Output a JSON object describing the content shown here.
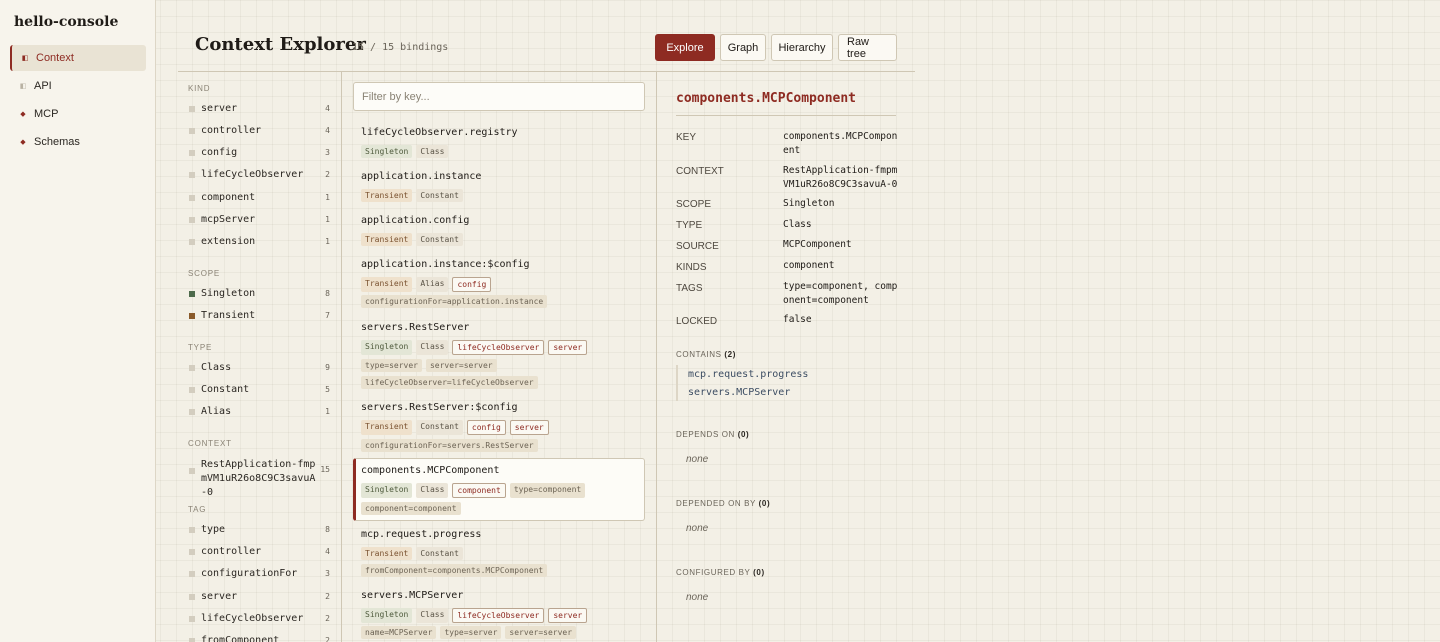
{
  "app": {
    "brand": "hello-console"
  },
  "nav": [
    {
      "label": "Context",
      "icon": "context-icon"
    },
    {
      "label": "API",
      "icon": "api-icon"
    },
    {
      "label": "MCP",
      "icon": "mcp-icon"
    },
    {
      "label": "Schemas",
      "icon": "schemas-icon"
    }
  ],
  "header": {
    "title": "Context Explorer",
    "count": "15 / 15 bindings",
    "views": [
      "Explore",
      "Graph",
      "Hierarchy",
      "Raw tree"
    ],
    "active_view": "Explore"
  },
  "facets": {
    "kind": {
      "heading": "KIND",
      "items": [
        {
          "label": "server",
          "count": "4"
        },
        {
          "label": "controller",
          "count": "4"
        },
        {
          "label": "config",
          "count": "3"
        },
        {
          "label": "lifeCycleObserver",
          "count": "2"
        },
        {
          "label": "component",
          "count": "1"
        },
        {
          "label": "mcpServer",
          "count": "1"
        },
        {
          "label": "extension",
          "count": "1"
        }
      ]
    },
    "scope": {
      "heading": "SCOPE",
      "items": [
        {
          "label": "Singleton",
          "count": "8"
        },
        {
          "label": "Transient",
          "count": "7"
        }
      ]
    },
    "type": {
      "heading": "TYPE",
      "items": [
        {
          "label": "Class",
          "count": "9"
        },
        {
          "label": "Constant",
          "count": "5"
        },
        {
          "label": "Alias",
          "count": "1"
        }
      ]
    },
    "context": {
      "heading": "CONTEXT",
      "items": [
        {
          "label": "RestApplication-fmpmVM1uR26o8C9C3savuA-0",
          "count": "15"
        }
      ]
    },
    "tag": {
      "heading": "TAG",
      "items": [
        {
          "label": "type",
          "count": "8"
        },
        {
          "label": "controller",
          "count": "4"
        },
        {
          "label": "configurationFor",
          "count": "3"
        },
        {
          "label": "server",
          "count": "2"
        },
        {
          "label": "lifeCycleObserver",
          "count": "2"
        },
        {
          "label": "fromComponent",
          "count": "2"
        }
      ]
    }
  },
  "filter": {
    "placeholder": "Filter by key...",
    "value": ""
  },
  "bindings": [
    {
      "key": "lifeCycleObserver.registry",
      "rows": [
        [
          "Singleton",
          "Class"
        ]
      ]
    },
    {
      "key": "application.instance",
      "rows": [
        [
          "Transient",
          "Constant"
        ]
      ]
    },
    {
      "key": "application.config",
      "rows": [
        [
          "Transient",
          "Constant"
        ]
      ]
    },
    {
      "key": "application.instance:$config",
      "rows": [
        [
          "Transient",
          "Alias",
          "config"
        ],
        [
          "configurationFor=application.instance"
        ]
      ]
    },
    {
      "key": "servers.RestServer",
      "rows": [
        [
          "Singleton",
          "Class",
          "lifeCycleObserver",
          "server"
        ],
        [
          "type=server",
          "server=server"
        ],
        [
          "lifeCycleObserver=lifeCycleObserver"
        ]
      ]
    },
    {
      "key": "servers.RestServer:$config",
      "rows": [
        [
          "Transient",
          "Constant",
          "config",
          "server"
        ],
        [
          "configurationFor=servers.RestServer"
        ]
      ]
    },
    {
      "key": "components.MCPComponent",
      "rows": [
        [
          "Singleton",
          "Class",
          "component",
          "type=component"
        ],
        [
          "component=component"
        ]
      ]
    },
    {
      "key": "mcp.request.progress",
      "rows": [
        [
          "Transient",
          "Constant"
        ],
        [
          "fromComponent=components.MCPComponent"
        ]
      ]
    },
    {
      "key": "servers.MCPServer",
      "rows": [
        [
          "Singleton",
          "Class",
          "lifeCycleObserver",
          "server"
        ],
        [
          "name=MCPServer",
          "type=server",
          "server=server"
        ]
      ]
    }
  ],
  "selected_binding": "components.MCPComponent",
  "details": {
    "title": "components.MCPComponent",
    "props": [
      {
        "label": "KEY",
        "value": "components.MCPComponent"
      },
      {
        "label": "CONTEXT",
        "value": "RestApplication-fmpmVM1uR26o8C9C3savuA-0"
      },
      {
        "label": "SCOPE",
        "value": "Singleton"
      },
      {
        "label": "TYPE",
        "value": "Class"
      },
      {
        "label": "SOURCE",
        "value": "MCPComponent"
      },
      {
        "label": "KINDS",
        "value": "component"
      },
      {
        "label": "TAGS",
        "value": "type=component, component=component"
      },
      {
        "label": "LOCKED",
        "value": "false"
      }
    ],
    "contains": {
      "label": "CONTAINS",
      "count": "(2)",
      "items": [
        "mcp.request.progress",
        "servers.MCPServer"
      ]
    },
    "depends_on": {
      "label": "DEPENDS ON",
      "count": "(0)",
      "empty": "none"
    },
    "depended_on_by": {
      "label": "DEPENDED ON BY",
      "count": "(0)",
      "empty": "none"
    },
    "configured_by": {
      "label": "CONFIGURED BY",
      "count": "(0)",
      "empty": "none"
    }
  },
  "colors": {
    "accent": "#8e2b22",
    "singleton": "#4e6b4c",
    "transient": "#8a5a2a"
  }
}
